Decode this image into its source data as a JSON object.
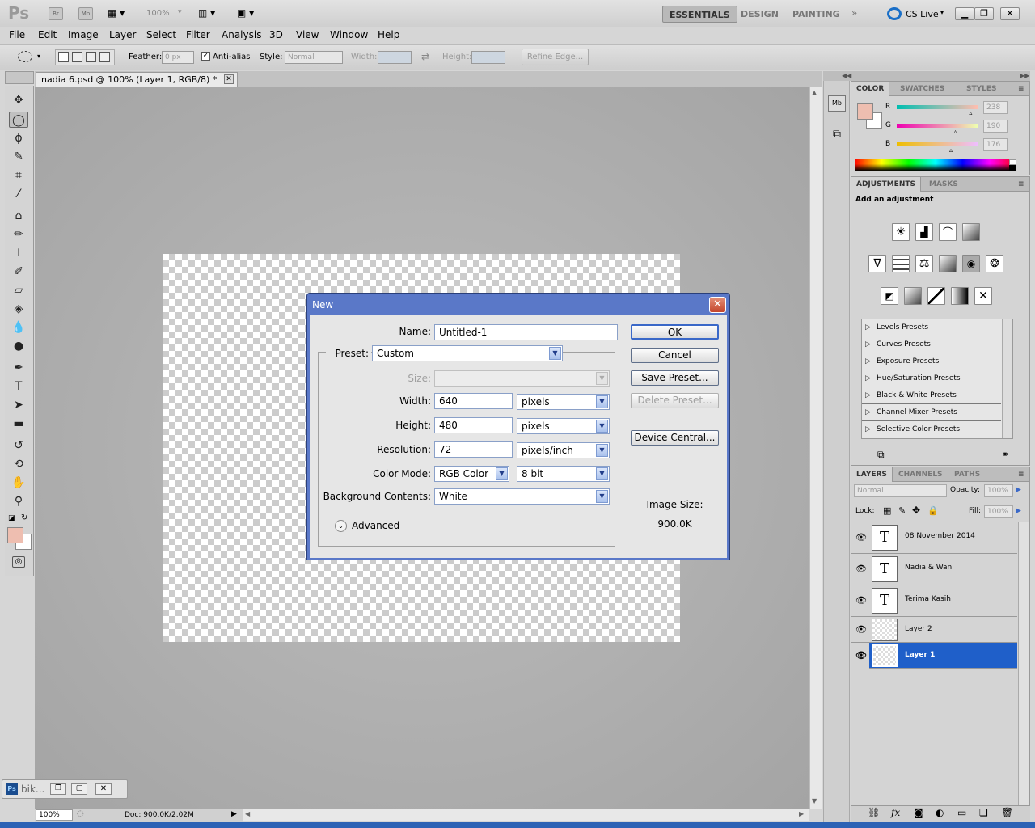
{
  "app": {
    "logo": "Ps",
    "launch_br": "Br",
    "launch_mb": "Mb",
    "zoom_menu": "100%",
    "workspaces": [
      "ESSENTIALS",
      "DESIGN",
      "PAINTING"
    ],
    "cs_live": "CS Live"
  },
  "menu": [
    "File",
    "Edit",
    "Image",
    "Layer",
    "Select",
    "Filter",
    "Analysis",
    "3D",
    "View",
    "Window",
    "Help"
  ],
  "options": {
    "feather_label": "Feather:",
    "feather_value": "0 px",
    "antialias_label": "Anti-alias",
    "antialias_checked": true,
    "style_label": "Style:",
    "style_value": "Normal",
    "width_label": "Width:",
    "height_label": "Height:",
    "refine_edge": "Refine Edge..."
  },
  "document": {
    "tab_title": "nadia 6.psd @ 100% (Layer 1, RGB/8) *",
    "zoom": "100%",
    "doc_size": "Doc: 900.0K/2.02M"
  },
  "taskbar": {
    "item_label": "bik..."
  },
  "dialog": {
    "title": "New",
    "name_label": "Name:",
    "name_value": "Untitled-1",
    "preset_label": "Preset:",
    "preset_value": "Custom",
    "size_label": "Size:",
    "width_label": "Width:",
    "width_value": "640",
    "width_unit": "pixels",
    "height_label": "Height:",
    "height_value": "480",
    "height_unit": "pixels",
    "resolution_label": "Resolution:",
    "resolution_value": "72",
    "resolution_unit": "pixels/inch",
    "colormode_label": "Color Mode:",
    "colormode_value": "RGB Color",
    "colordepth_value": "8 bit",
    "background_label": "Background Contents:",
    "background_value": "White",
    "advanced_label": "Advanced",
    "ok": "OK",
    "cancel": "Cancel",
    "save_preset": "Save Preset...",
    "delete_preset": "Delete Preset...",
    "device_central": "Device Central...",
    "image_size_label": "Image Size:",
    "image_size_value": "900.0K"
  },
  "color_panel": {
    "tabs": [
      "COLOR",
      "SWATCHES",
      "STYLES"
    ],
    "r_label": "R",
    "g_label": "G",
    "b_label": "B",
    "r_value": "238",
    "g_value": "190",
    "b_value": "176",
    "foreground": "#eebeb0",
    "background": "#ffffff"
  },
  "adjustments_panel": {
    "tabs": [
      "ADJUSTMENTS",
      "MASKS"
    ],
    "heading": "Add an adjustment",
    "presets": [
      "Levels Presets",
      "Curves Presets",
      "Exposure Presets",
      "Hue/Saturation Presets",
      "Black & White Presets",
      "Channel Mixer Presets",
      "Selective Color Presets"
    ]
  },
  "layers_panel": {
    "tabs": [
      "LAYERS",
      "CHANNELS",
      "PATHS"
    ],
    "blend_mode": "Normal",
    "opacity_label": "Opacity:",
    "opacity_value": "100%",
    "lock_label": "Lock:",
    "fill_label": "Fill:",
    "fill_value": "100%",
    "layers": [
      {
        "name": "08 November 2014",
        "type": "text"
      },
      {
        "name": "Nadia & Wan",
        "type": "text"
      },
      {
        "name": "Terima Kasih",
        "type": "text"
      },
      {
        "name": "Layer 2",
        "type": "raster"
      },
      {
        "name": "Layer 1",
        "type": "raster",
        "selected": true
      }
    ]
  }
}
